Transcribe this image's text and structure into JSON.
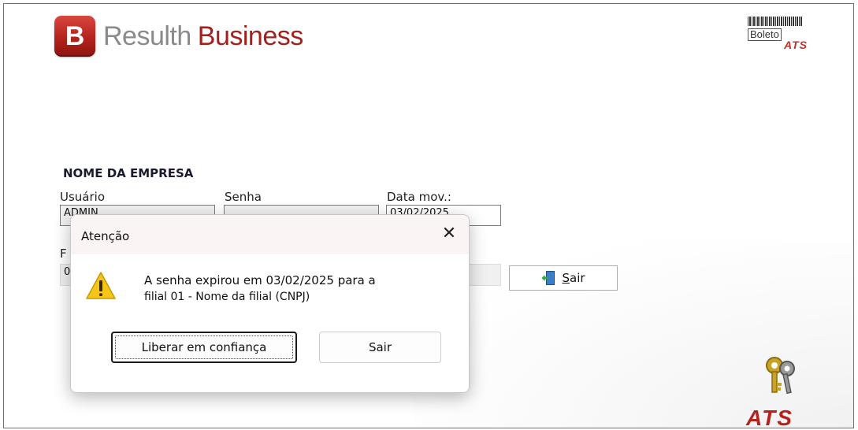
{
  "header": {
    "logo_letter": "B",
    "brand_light": "Resulth",
    "brand_bold": "Business",
    "boleto_text": "Boleto",
    "boleto_sub": "ATS"
  },
  "form": {
    "company_name": "NOME DA EMPRESA",
    "user_label": "Usuário",
    "user_value": "ADMIN",
    "password_label": "Senha",
    "date_label": "Data mov.:",
    "date_value": "03/02/2025",
    "branch_label_partial": "F",
    "branch_value_partial": "0",
    "exit_button": "Sair"
  },
  "footer": {
    "ats_logo": "ATS"
  },
  "dialog": {
    "title": "Atenção",
    "close_glyph": "✕",
    "message_line1": "A senha expirou em 03/02/2025 para a",
    "message_line2": "filial 01 - Nome da filial (CNPJ)",
    "primary_button": "Liberar em confiança",
    "secondary_button": "Sair"
  },
  "colors": {
    "brand_red": "#a3201d",
    "brand_grey": "#8a8a8a",
    "warning_yellow": "#f5c518"
  },
  "icons": [
    "logo-b-icon",
    "barcode-icon",
    "exit-door-icon",
    "keys-icon",
    "warning-icon",
    "close-icon"
  ]
}
